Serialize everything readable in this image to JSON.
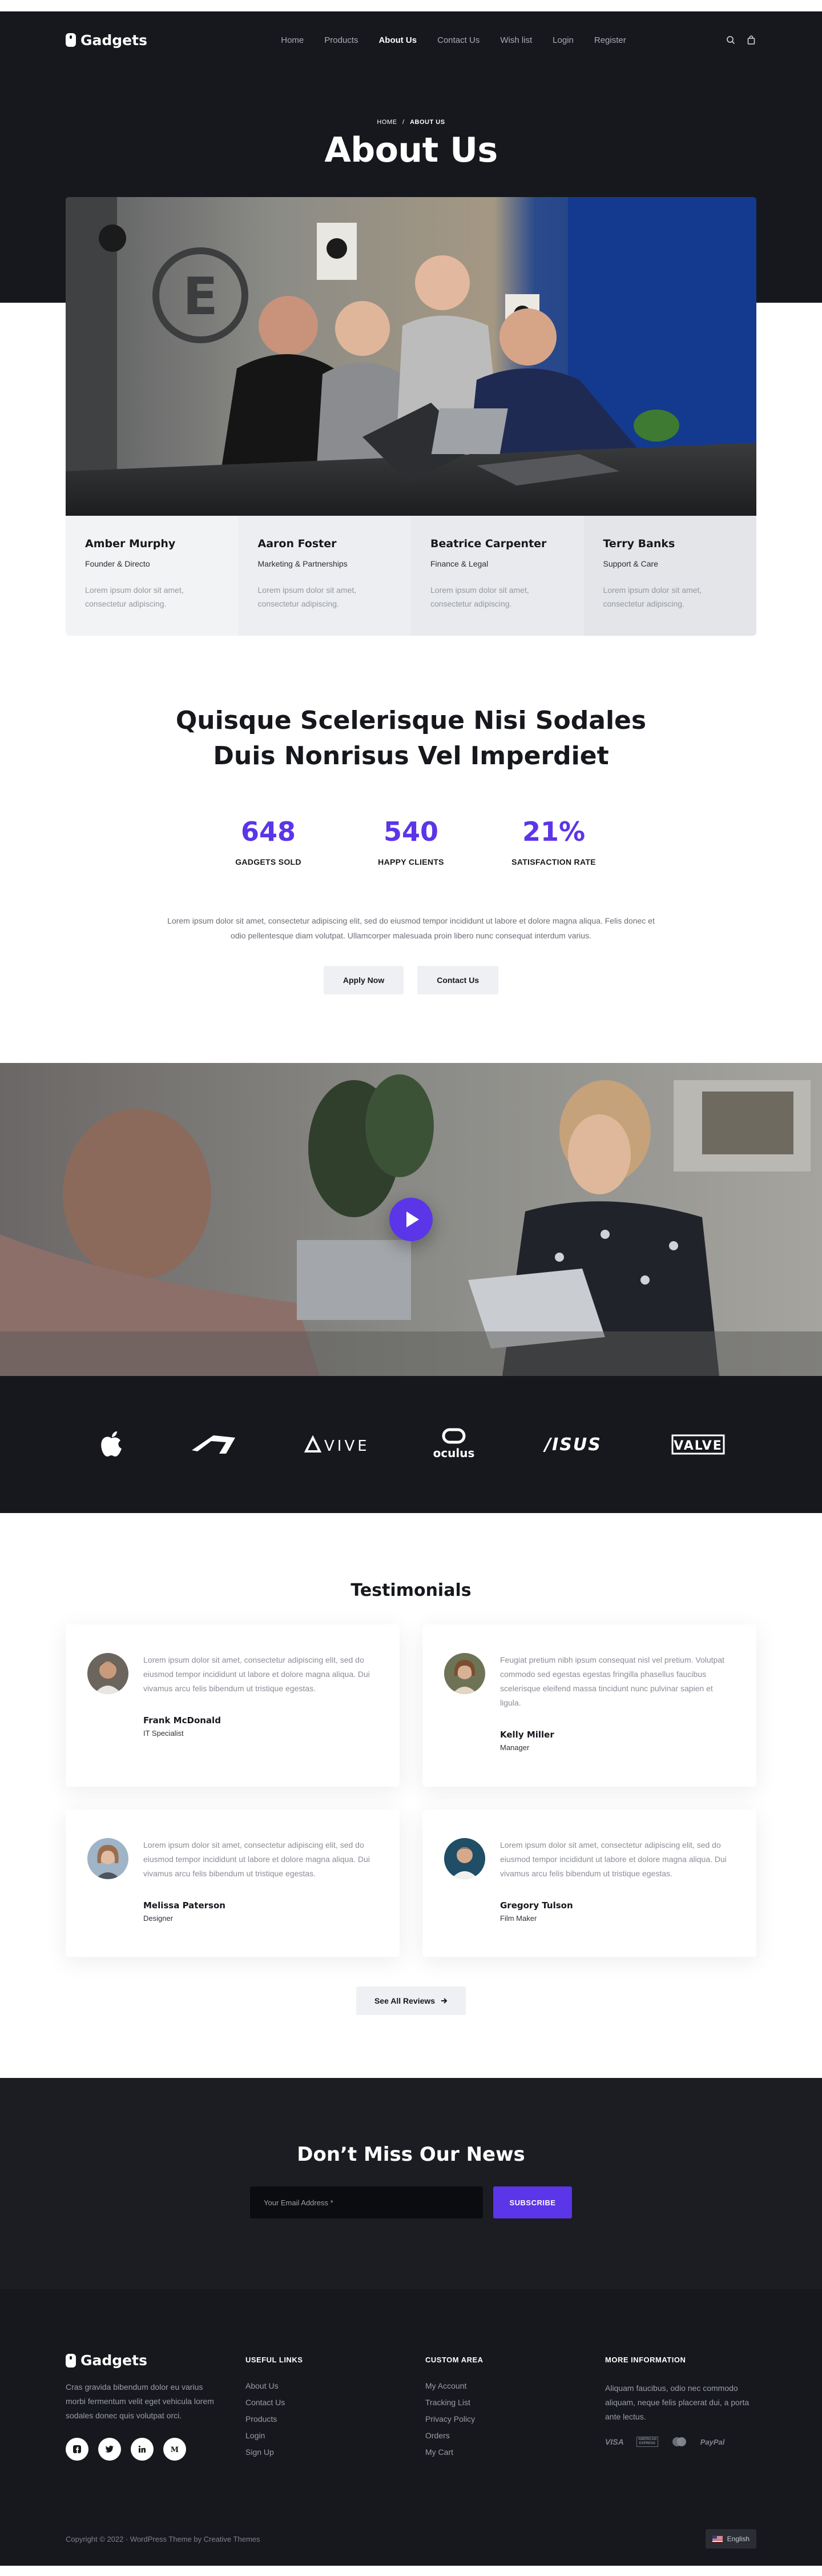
{
  "brand": {
    "name": "Gadgets"
  },
  "nav": {
    "items": [
      "Home",
      "Products",
      "About Us",
      "Contact Us",
      "Wish list",
      "Login",
      "Register"
    ],
    "active": "About Us",
    "icons": [
      "search-icon",
      "bag-icon"
    ]
  },
  "hero": {
    "breadcrumb": {
      "home": "HOME",
      "separator": "/",
      "current": "ABOUT US"
    },
    "title": "About Us"
  },
  "team": [
    {
      "name": "Amber Murphy",
      "role": "Founder & Directo",
      "desc": "Lorem ipsum dolor sit amet, consectetur adipiscing."
    },
    {
      "name": "Aaron Foster",
      "role": "Marketing & Partnerships",
      "desc": "Lorem ipsum dolor sit amet, consectetur adipiscing."
    },
    {
      "name": "Beatrice Carpenter",
      "role": "Finance & Legal",
      "desc": "Lorem ipsum dolor sit amet, consectetur adipiscing."
    },
    {
      "name": "Terry Banks",
      "role": "Support & Care",
      "desc": "Lorem ipsum dolor sit amet, consectetur adipiscing."
    }
  ],
  "stats": {
    "heading_line1": "Quisque Scelerisque Nisi Sodales",
    "heading_line2": "Duis Nonrisus Vel Imperdiet",
    "items": [
      {
        "value": "648",
        "label": "GADGETS SOLD"
      },
      {
        "value": "540",
        "label": "HAPPY CLIENTS"
      },
      {
        "value": "21%",
        "label": "SATISFACTION RATE"
      }
    ],
    "paragraph": "Lorem ipsum dolor sit amet, consectetur adipiscing elit, sed do eiusmod tempor incididunt ut labore et dolore magna aliqua. Felis donec et odio pellentesque diam volutpat. Ullamcorper malesuada proin libero nunc consequat interdum varius.",
    "buttons": {
      "apply": "Apply Now",
      "contact": "Contact Us"
    }
  },
  "video": {
    "play_icon": "play-icon"
  },
  "brands": [
    {
      "name": "Apple",
      "icon": "apple-logo-icon"
    },
    {
      "name": "ROG",
      "icon": "rog-logo-icon"
    },
    {
      "name": "VIVE",
      "icon": "vive-logo-icon"
    },
    {
      "name": "oculus",
      "icon": "oculus-logo-icon"
    },
    {
      "name": "ASUS",
      "icon": "asus-logo-icon"
    },
    {
      "name": "VALVE",
      "icon": "valve-logo-icon"
    }
  ],
  "testimonials": {
    "title": "Testimonials",
    "items": [
      {
        "text": "Lorem ipsum dolor sit amet, consectetur adipiscing elit, sed do eiusmod tempor incididunt ut labore et dolore magna aliqua. Dui vivamus arcu felis bibendum ut tristique egestas.",
        "name": "Frank McDonald",
        "role": "IT Specialist"
      },
      {
        "text": "Feugiat pretium nibh ipsum consequat nisl vel pretium. Volutpat commodo sed egestas egestas fringilla phasellus faucibus scelerisque eleifend massa tincidunt nunc pulvinar sapien et ligula.",
        "name": "Kelly Miller",
        "role": "Manager"
      },
      {
        "text": "Lorem ipsum dolor sit amet, consectetur adipiscing elit, sed do eiusmod tempor incididunt ut labore et dolore magna aliqua. Dui vivamus arcu felis bibendum ut tristique egestas.",
        "name": "Melissa Paterson",
        "role": "Designer"
      },
      {
        "text": "Lorem ipsum dolor sit amet, consectetur adipiscing elit, sed do eiusmod tempor incididunt ut labore et dolore magna aliqua. Dui vivamus arcu felis bibendum ut tristique egestas.",
        "name": "Gregory Tulson",
        "role": "Film Maker"
      }
    ],
    "see_all": "See All Reviews"
  },
  "newsletter": {
    "title": "Don’t Miss Our News",
    "placeholder": "Your Email Address *",
    "button": "SUBSCRIBE"
  },
  "footer": {
    "description": "Cras gravida bibendum dolor eu varius morbi fermentum velit eget vehicula lorem sodales donec quis volutpat orci.",
    "socials": [
      "facebook-icon",
      "twitter-icon",
      "linkedin-icon",
      "medium-icon"
    ],
    "useful_links": {
      "heading": "USEFUL LINKS",
      "items": [
        "About Us",
        "Contact Us",
        "Products",
        "Login",
        "Sign Up"
      ]
    },
    "custom_area": {
      "heading": "CUSTOM AREA",
      "items": [
        "My Account",
        "Tracking List",
        "Privacy Policy",
        "Orders",
        "My Cart"
      ]
    },
    "more_info": {
      "heading": "MORE INFORMATION",
      "text": "Aliquam faucibus, odio nec commodo aliquam, neque felis placerat dui, a porta ante lectus.",
      "payments": [
        "VISA",
        "AMERICAN EXPRESS",
        "mastercard",
        "PayPal"
      ]
    },
    "copyright": "Copyright © 2022 · WordPress Theme by Creative Themes",
    "language": "English"
  },
  "colors": {
    "accent": "#5b35e8",
    "dark": "#16181d",
    "dark2": "#1b1d22",
    "light": "#eef0f3"
  }
}
